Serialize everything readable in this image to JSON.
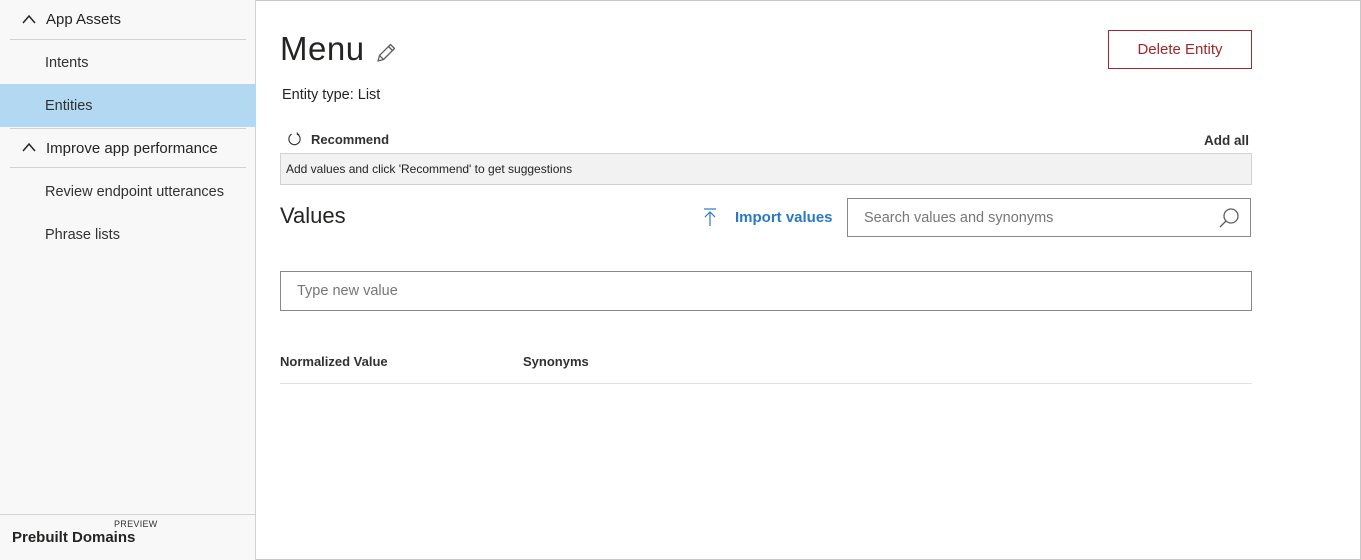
{
  "sidebar": {
    "sections": [
      {
        "label": "App Assets"
      },
      {
        "label": "Improve app performance"
      }
    ],
    "items": [
      {
        "label": "Intents"
      },
      {
        "label": "Entities"
      },
      {
        "label": "Review endpoint utterances"
      },
      {
        "label": "Phrase lists"
      }
    ],
    "bottom": {
      "label": "Prebuilt Domains",
      "badge": "PREVIEW"
    }
  },
  "entity": {
    "title": "Menu",
    "type_text": "Entity type: List",
    "delete_label": "Delete Entity"
  },
  "recommend": {
    "label": "Recommend",
    "add_all": "Add all",
    "hint": "Add values and click 'Recommend' to get suggestions"
  },
  "values": {
    "title": "Values",
    "import_label": "Import values",
    "search_placeholder": "Search values and synonyms",
    "new_value_placeholder": "Type new value",
    "columns": [
      "Normalized Value",
      "Synonyms"
    ]
  },
  "colors": {
    "accent": "#2b79c5",
    "danger": "#a4262c",
    "active_bg": "#b3d9f2"
  }
}
